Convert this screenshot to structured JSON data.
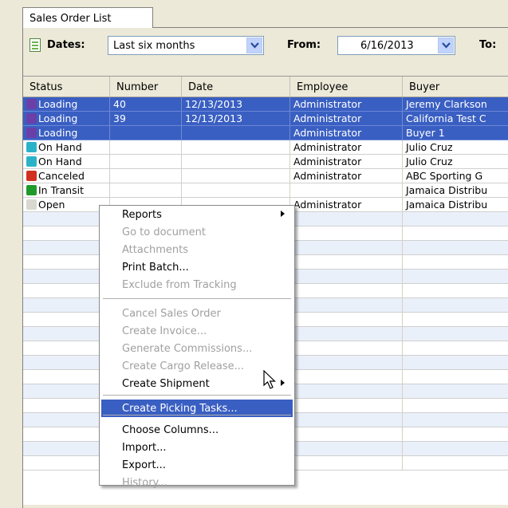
{
  "tab": {
    "label": "Sales Order List"
  },
  "toolbar": {
    "dates_label": "Dates:",
    "dates_value": "Last six months",
    "from_label": "From:",
    "from_value": "6/16/2013",
    "to_label": "To:"
  },
  "columns": [
    "Status",
    "Number",
    "Date",
    "Employee",
    "Buyer"
  ],
  "rows": [
    {
      "status": "Loading",
      "icon_color": "#6a3fa8",
      "number": "40",
      "date": "12/13/2013",
      "employee": "Administrator",
      "buyer": "Jeremy Clarkson",
      "selected": true
    },
    {
      "status": "Loading",
      "icon_color": "#6a3fa8",
      "number": "39",
      "date": "12/13/2013",
      "employee": "Administrator",
      "buyer": "California Test C",
      "selected": true
    },
    {
      "status": "Loading",
      "icon_color": "#6a3fa8",
      "number": "",
      "date": "",
      "employee": "Administrator",
      "buyer": "Buyer 1",
      "selected": true
    },
    {
      "status": "On Hand",
      "icon_color": "#2ab3c8",
      "number": "",
      "date": "",
      "employee": "Administrator",
      "buyer": "Julio Cruz",
      "selected": false
    },
    {
      "status": "On Hand",
      "icon_color": "#2ab3c8",
      "number": "",
      "date": "",
      "employee": "Administrator",
      "buyer": "Julio Cruz",
      "selected": false
    },
    {
      "status": "Canceled",
      "icon_color": "#d03020",
      "number": "",
      "date": "",
      "employee": "Administrator",
      "buyer": "ABC Sporting G",
      "selected": false
    },
    {
      "status": "In Transit",
      "icon_color": "#1f9a2a",
      "number": "",
      "date": "",
      "employee": "",
      "buyer": "Jamaica Distribu",
      "selected": false
    },
    {
      "status": "Open",
      "icon_color": "#d8d8d0",
      "number": "",
      "date": "",
      "employee": "Administrator",
      "buyer": "Jamaica Distribu",
      "selected": false
    }
  ],
  "context_menu": {
    "items": [
      {
        "label": "Reports",
        "submenu": true
      },
      {
        "label": "Go to document",
        "disabled": true
      },
      {
        "label": "Attachments",
        "disabled": true
      },
      {
        "label": "Print Batch..."
      },
      {
        "label": "Exclude from Tracking",
        "disabled": true
      },
      {
        "label": "Cancel Sales Order",
        "disabled": true
      },
      {
        "label": "Create Invoice...",
        "disabled": true
      },
      {
        "label": "Generate Commissions...",
        "disabled": true
      },
      {
        "label": "Create Cargo Release...",
        "disabled": true
      },
      {
        "label": "Create Shipment",
        "submenu": true
      },
      {
        "label": "Create Picking Tasks...",
        "highlighted": true
      },
      {
        "label": "Choose Columns..."
      },
      {
        "label": "Import..."
      },
      {
        "label": "Export..."
      },
      {
        "label": "History...",
        "disabled": true
      }
    ]
  }
}
